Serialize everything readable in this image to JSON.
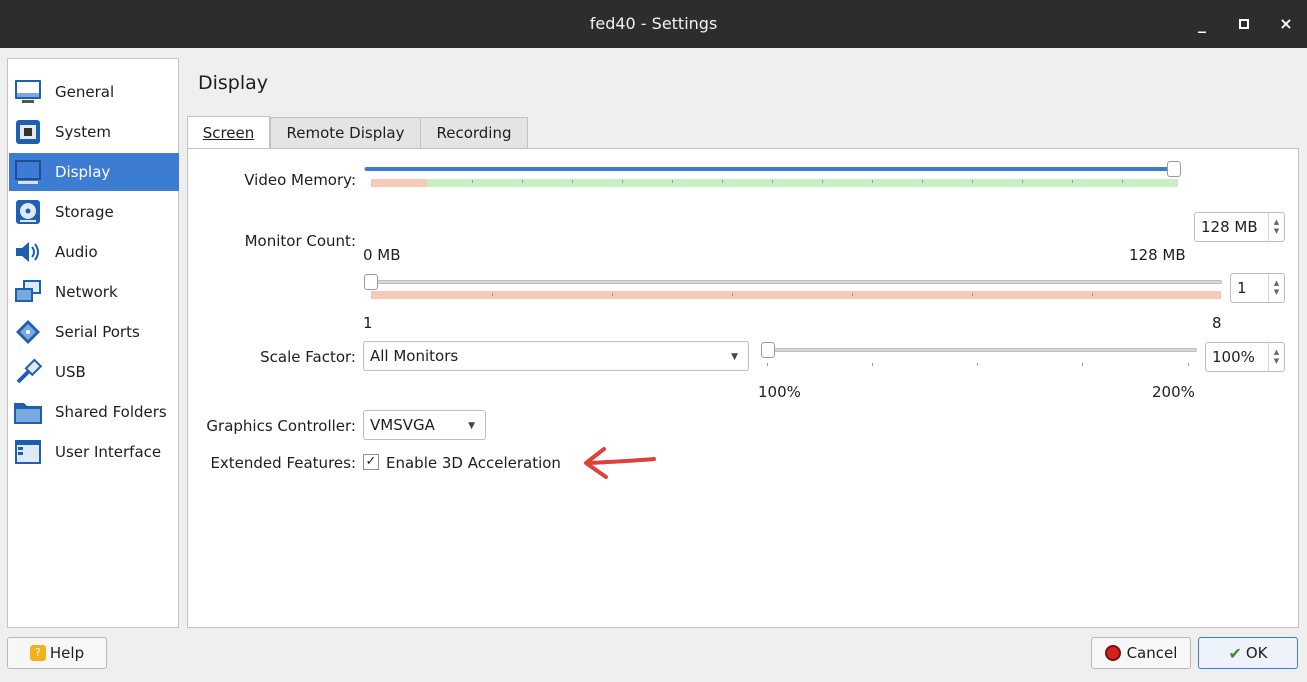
{
  "window": {
    "title": "fed40 - Settings",
    "minimize_glyph": "_",
    "close_glyph": "×"
  },
  "sidebar": {
    "items": [
      {
        "label": "General",
        "icon": "general-monitor-icon",
        "selected": false
      },
      {
        "label": "System",
        "icon": "chip-icon",
        "selected": false
      },
      {
        "label": "Display",
        "icon": "display-icon",
        "selected": true
      },
      {
        "label": "Storage",
        "icon": "disk-icon",
        "selected": false
      },
      {
        "label": "Audio",
        "icon": "speaker-icon",
        "selected": false
      },
      {
        "label": "Network",
        "icon": "network-icon",
        "selected": false
      },
      {
        "label": "Serial Ports",
        "icon": "serial-port-icon",
        "selected": false
      },
      {
        "label": "USB",
        "icon": "usb-icon",
        "selected": false
      },
      {
        "label": "Shared Folders",
        "icon": "folder-icon",
        "selected": false
      },
      {
        "label": "User Interface",
        "icon": "window-icon",
        "selected": false
      }
    ]
  },
  "panel": {
    "title": "Display",
    "tabs": [
      {
        "label": "Screen",
        "active": true
      },
      {
        "label": "Remote Display",
        "active": false
      },
      {
        "label": "Recording",
        "active": false
      }
    ]
  },
  "screen": {
    "video_memory": {
      "label": "Video Memory:",
      "value": "128 MB",
      "value_mb": 128,
      "min_label": "0 MB",
      "max_label": "128 MB",
      "fraction": 1.0
    },
    "monitor_count": {
      "label": "Monitor Count:",
      "value": "1",
      "min_label": "1",
      "max_label": "8",
      "fraction": 0.0
    },
    "scale_factor": {
      "label": "Scale Factor:",
      "combo_value": "All Monitors",
      "value": "100%",
      "min_label": "100%",
      "max_label": "200%",
      "fraction": 0.0
    },
    "graphics_controller": {
      "label": "Graphics Controller:",
      "value": "VMSVGA"
    },
    "extended_features": {
      "label": "Extended Features:",
      "checkbox_label": "Enable 3D Acceleration",
      "checked": true,
      "check_glyph": "✓"
    }
  },
  "annotation": {
    "arrow_color": "#e0403a"
  },
  "footer": {
    "help_label": "Help",
    "cancel_label": "Cancel",
    "ok_label": "OK"
  },
  "colors": {
    "accent": "#3d7cd3",
    "titlebar": "#2d2d2d"
  }
}
